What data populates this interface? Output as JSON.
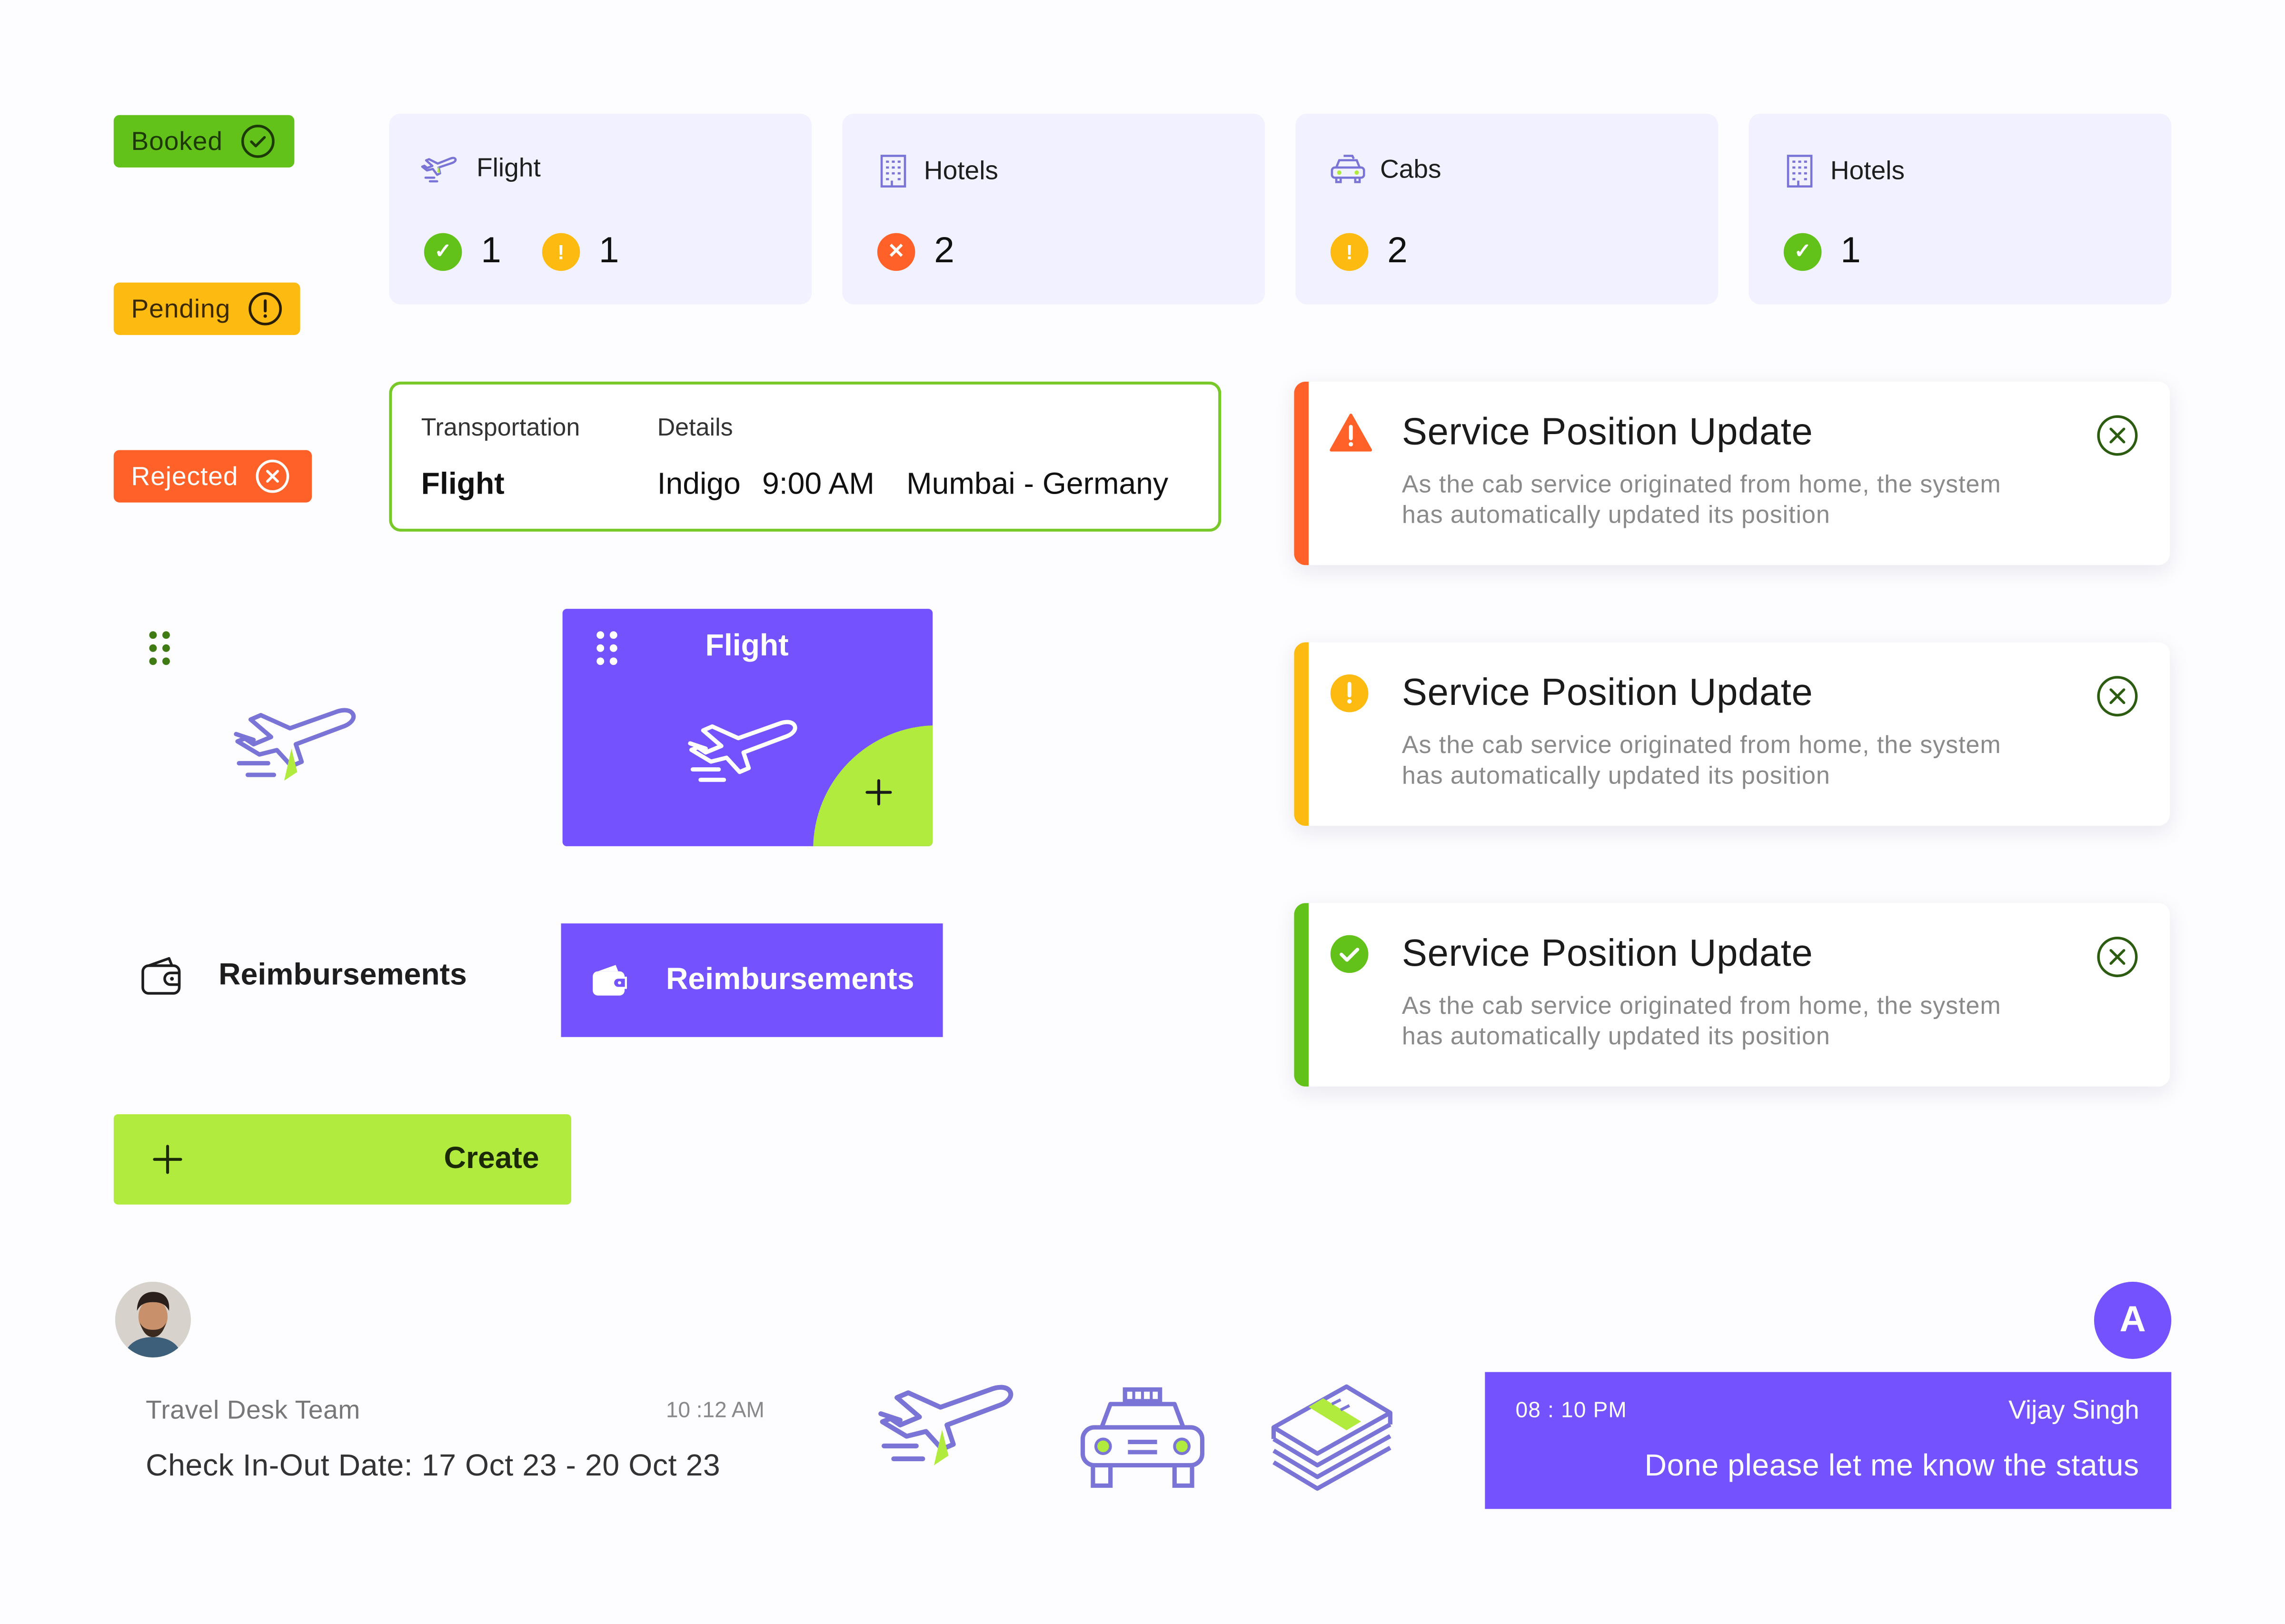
{
  "colors": {
    "green": "#63c21a",
    "amber": "#fdbb12",
    "orange": "#ff6128",
    "purple": "#7452fe",
    "lime": "#b0eb3e",
    "card": "#f2f1ff"
  },
  "status_pills": {
    "booked": "Booked",
    "pending": "Pending",
    "rejected": "Rejected"
  },
  "summary": [
    {
      "title": "Flight",
      "icon": "plane-icon",
      "stats": [
        {
          "status": "booked",
          "count": "1"
        },
        {
          "status": "pending",
          "count": "1"
        }
      ]
    },
    {
      "title": "Hotels",
      "icon": "building-icon",
      "stats": [
        {
          "status": "rejected",
          "count": "2"
        }
      ]
    },
    {
      "title": "Cabs",
      "icon": "car-icon",
      "stats": [
        {
          "status": "pending",
          "count": "2"
        }
      ]
    },
    {
      "title": "Hotels",
      "icon": "building-icon",
      "stats": [
        {
          "status": "booked",
          "count": "1"
        }
      ]
    }
  ],
  "transport": {
    "header_transportation": "Transportation",
    "header_details": "Details",
    "mode": "Flight",
    "airline": "Indigo",
    "time": "9:00 AM",
    "route": "Mumbai - Germany"
  },
  "notifications": [
    {
      "level": "error",
      "title": "Service Position Update",
      "message": "As the cab service originated from home, the system has automatically updated its position"
    },
    {
      "level": "warning",
      "title": "Service Position Update",
      "message": "As the cab service originated from home, the system has automatically updated its position"
    },
    {
      "level": "success",
      "title": "Service Position Update",
      "message": "As the cab service originated from home, the system has automatically updated its position"
    }
  ],
  "flight_tile": {
    "label": "Flight"
  },
  "reimbursements": {
    "plain_label": "Reimbursements",
    "button_label": "Reimbursements"
  },
  "create": {
    "label": "Create"
  },
  "chat": {
    "from": "Travel Desk Team",
    "time": "10 :12 AM",
    "text": "Check In-Out Date: 17 Oct 23 - 20 Oct 23"
  },
  "reply": {
    "avatar_initial": "A",
    "time": "08 : 10 PM",
    "name": "Vijay Singh",
    "text": "Done please let me know the status"
  },
  "illustrations": [
    "plane-icon",
    "taxi-icon",
    "money-stack-icon"
  ]
}
